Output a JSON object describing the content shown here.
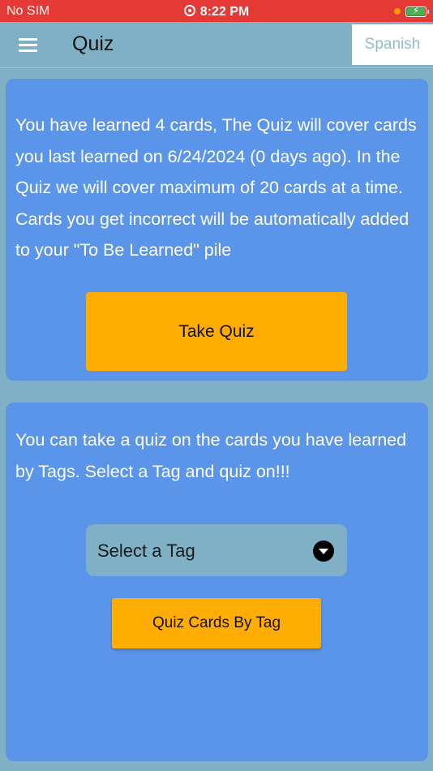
{
  "status_bar": {
    "carrier": "No SIM",
    "time": "8:22 PM"
  },
  "app_bar": {
    "title": "Quiz",
    "language": "Spanish"
  },
  "quiz_card": {
    "description": "You have learned 4 cards, The Quiz will cover cards you last learned on 6/24/2024 (0 days ago). In the Quiz we will cover maximum of 20 cards at a time. Cards you get incorrect will be automatically added to your \"To Be Learned\" pile",
    "button_label": "Take Quiz"
  },
  "tag_card": {
    "description": "You can take a quiz on the cards you have learned by Tags. Select a Tag and quiz on!!!",
    "select_placeholder": "Select a Tag",
    "button_label": "Quiz Cards By Tag"
  },
  "colors": {
    "background": "#7fb0c5",
    "status_bar": "#e53935",
    "card": "#5b95ea",
    "accent_button": "#ffac03"
  },
  "icons": {
    "menu": "hamburger-menu-icon",
    "dropdown": "chevron-down-circle-icon",
    "alarm": "alarm-icon",
    "battery": "battery-charging-icon"
  }
}
